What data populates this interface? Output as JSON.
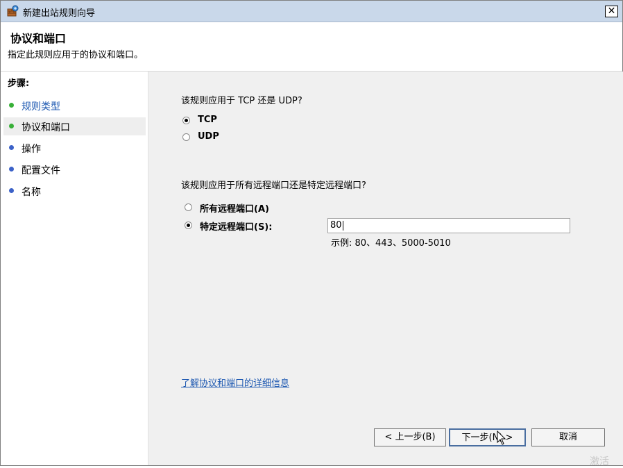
{
  "window": {
    "title": "新建出站规则向导",
    "close_label": "✕"
  },
  "header": {
    "title": "协议和端口",
    "subtitle": "指定此规则应用于的协议和端口。"
  },
  "steps": {
    "title": "步骤:",
    "items": [
      {
        "label": "规则类型",
        "state": "done",
        "dot_color": "#38b038"
      },
      {
        "label": "协议和端口",
        "state": "current",
        "dot_color": "#38b038"
      },
      {
        "label": "操作",
        "state": "pending",
        "dot_color": "#3c62c8"
      },
      {
        "label": "配置文件",
        "state": "pending",
        "dot_color": "#3c62c8"
      },
      {
        "label": "名称",
        "state": "pending",
        "dot_color": "#3c62c8"
      }
    ]
  },
  "protocol": {
    "question": "该规则应用于 TCP 还是 UDP?",
    "options": [
      {
        "label": "TCP",
        "checked": true
      },
      {
        "label": "UDP",
        "checked": false
      }
    ]
  },
  "ports": {
    "question": "该规则应用于所有远程端口还是特定远程端口?",
    "options": [
      {
        "label": "所有远程端口(A)",
        "checked": false
      },
      {
        "label": "特定远程端口(S):",
        "checked": true
      }
    ],
    "value": "80",
    "example": "示例: 80、443、5000-5010"
  },
  "learn_more": "了解协议和端口的详细信息",
  "buttons": {
    "back": "< 上一步(B)",
    "next": "下一步(N) >",
    "cancel": "取消"
  },
  "watermark": "激活"
}
